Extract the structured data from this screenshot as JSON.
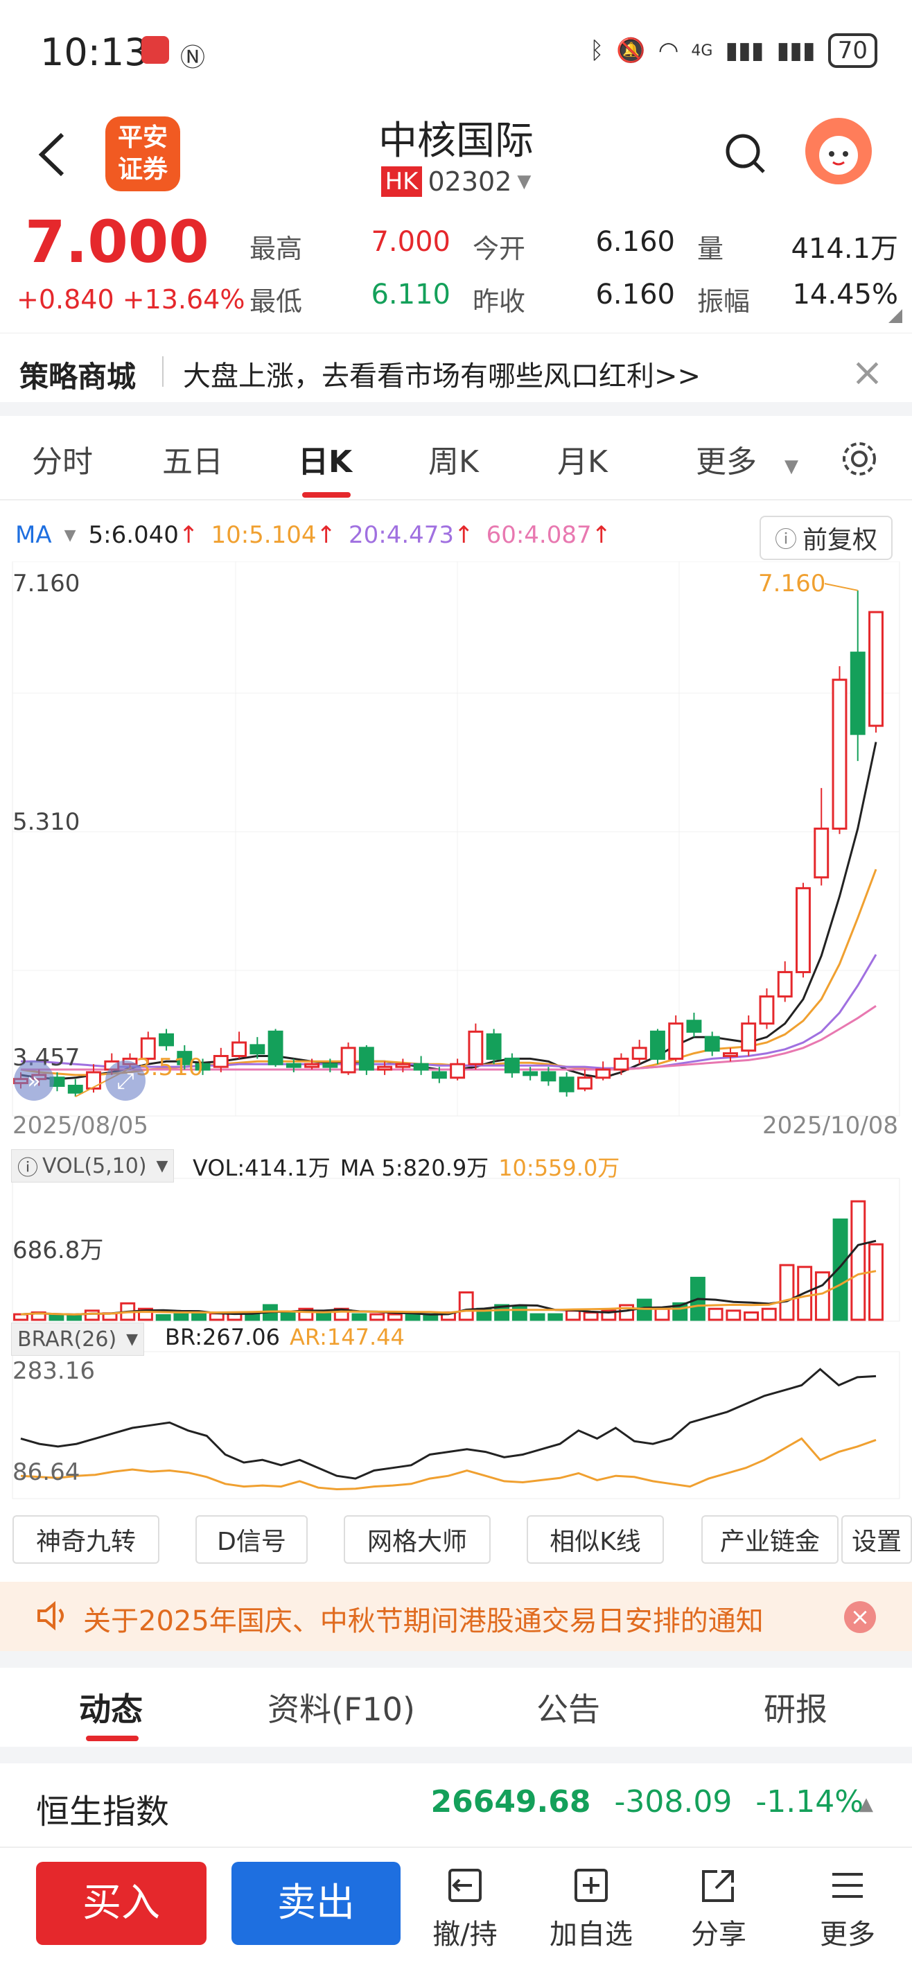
{
  "status": {
    "time": "10:13",
    "battery": "70",
    "net": "4G"
  },
  "header": {
    "stock_name": "中核国际",
    "market": "HK",
    "code": "02302",
    "broker_logo": "平安证券"
  },
  "quote": {
    "price": "7.000",
    "change": "+0.840",
    "change_pct": "+13.64%",
    "high_label": "最高",
    "high": "7.000",
    "low_label": "最低",
    "low": "6.110",
    "open_label": "今开",
    "open": "6.160",
    "prev_close_label": "昨收",
    "prev_close": "6.160",
    "volume_label": "量",
    "volume": "414.1万",
    "amplitude_label": "振幅",
    "amplitude": "14.45%"
  },
  "promo": {
    "title": "策略商城",
    "text": "大盘上涨，去看看市场有哪些风口红利>>"
  },
  "tabs": [
    {
      "label": "分时"
    },
    {
      "label": "五日"
    },
    {
      "label": "日K"
    },
    {
      "label": "周K"
    },
    {
      "label": "月K"
    },
    {
      "label": "更多"
    }
  ],
  "ma": {
    "label": "MA",
    "ma5": "5:6.040",
    "ma10": "10:5.104",
    "ma20": "20:4.473",
    "ma60": "60:4.087",
    "fq": "前复权"
  },
  "colors": {
    "red": "#e5282c",
    "green": "#14a05a",
    "ma5": "#222222",
    "ma10": "#f0a030",
    "ma20": "#a070e0",
    "ma60": "#e878b0"
  },
  "chart_data": {
    "type": "candlestick",
    "y_labels": [
      "7.160",
      "5.310",
      "3.457"
    ],
    "ylim": [
      3.4,
      7.2
    ],
    "start_date": "2025/08/05",
    "end_date": "2025/10/08",
    "max_label": "7.160",
    "min_label": "3.510",
    "candles": [
      [
        3.52,
        3.55,
        3.6,
        3.48
      ],
      [
        3.55,
        3.58,
        3.62,
        3.5
      ],
      [
        3.56,
        3.5,
        3.6,
        3.46
      ],
      [
        3.5,
        3.45,
        3.55,
        3.42
      ],
      [
        3.48,
        3.6,
        3.66,
        3.45
      ],
      [
        3.62,
        3.68,
        3.74,
        3.58
      ],
      [
        3.66,
        3.7,
        3.74,
        3.62
      ],
      [
        3.7,
        3.85,
        3.9,
        3.66
      ],
      [
        3.88,
        3.8,
        3.92,
        3.76
      ],
      [
        3.75,
        3.66,
        3.8,
        3.62
      ],
      [
        3.66,
        3.62,
        3.7,
        3.58
      ],
      [
        3.64,
        3.72,
        3.78,
        3.6
      ],
      [
        3.72,
        3.82,
        3.9,
        3.7
      ],
      [
        3.8,
        3.74,
        3.86,
        3.7
      ],
      [
        3.9,
        3.66,
        3.92,
        3.64
      ],
      [
        3.66,
        3.64,
        3.7,
        3.6
      ],
      [
        3.64,
        3.66,
        3.7,
        3.62
      ],
      [
        3.66,
        3.64,
        3.7,
        3.6
      ],
      [
        3.6,
        3.78,
        3.82,
        3.58
      ],
      [
        3.78,
        3.62,
        3.8,
        3.58
      ],
      [
        3.62,
        3.64,
        3.68,
        3.58
      ],
      [
        3.64,
        3.66,
        3.7,
        3.6
      ],
      [
        3.66,
        3.62,
        3.72,
        3.58
      ],
      [
        3.6,
        3.56,
        3.64,
        3.52
      ],
      [
        3.56,
        3.66,
        3.7,
        3.54
      ],
      [
        3.66,
        3.9,
        3.96,
        3.62
      ],
      [
        3.88,
        3.7,
        3.92,
        3.66
      ],
      [
        3.7,
        3.6,
        3.74,
        3.56
      ],
      [
        3.6,
        3.58,
        3.64,
        3.54
      ],
      [
        3.6,
        3.54,
        3.64,
        3.5
      ],
      [
        3.56,
        3.46,
        3.6,
        3.42
      ],
      [
        3.48,
        3.56,
        3.62,
        3.46
      ],
      [
        3.56,
        3.62,
        3.68,
        3.54
      ],
      [
        3.62,
        3.7,
        3.74,
        3.58
      ],
      [
        3.7,
        3.78,
        3.84,
        3.66
      ],
      [
        3.9,
        3.7,
        3.92,
        3.66
      ],
      [
        3.7,
        3.96,
        4.02,
        3.68
      ],
      [
        3.98,
        3.9,
        4.04,
        3.86
      ],
      [
        3.86,
        3.76,
        3.9,
        3.72
      ],
      [
        3.72,
        3.74,
        3.78,
        3.68
      ],
      [
        3.76,
        3.96,
        4.02,
        3.72
      ],
      [
        3.96,
        4.16,
        4.22,
        3.92
      ],
      [
        4.16,
        4.34,
        4.42,
        4.12
      ],
      [
        4.34,
        4.96,
        5.0,
        4.3
      ],
      [
        5.04,
        5.4,
        5.7,
        4.98
      ],
      [
        5.4,
        6.5,
        6.6,
        5.36
      ],
      [
        6.7,
        6.1,
        7.16,
        5.9
      ],
      [
        6.16,
        7.0,
        7.0,
        6.11
      ]
    ],
    "ma_lines": {
      "ma5": [
        3.58,
        3.56,
        3.55,
        3.56,
        3.58,
        3.6,
        3.63,
        3.66,
        3.68,
        3.68,
        3.67,
        3.68,
        3.7,
        3.72,
        3.72,
        3.7,
        3.68,
        3.67,
        3.67,
        3.68,
        3.68,
        3.66,
        3.64,
        3.62,
        3.62,
        3.64,
        3.68,
        3.7,
        3.7,
        3.68,
        3.62,
        3.58,
        3.56,
        3.6,
        3.66,
        3.72,
        3.8,
        3.86,
        3.86,
        3.84,
        3.82,
        3.86,
        3.96,
        4.14,
        4.46,
        4.9,
        5.4,
        6.04
      ],
      "ma10": [
        3.62,
        3.6,
        3.59,
        3.58,
        3.58,
        3.59,
        3.6,
        3.62,
        3.63,
        3.64,
        3.65,
        3.66,
        3.67,
        3.68,
        3.68,
        3.68,
        3.68,
        3.68,
        3.68,
        3.68,
        3.68,
        3.67,
        3.66,
        3.66,
        3.65,
        3.65,
        3.66,
        3.67,
        3.67,
        3.66,
        3.64,
        3.63,
        3.62,
        3.62,
        3.63,
        3.66,
        3.7,
        3.74,
        3.77,
        3.78,
        3.79,
        3.82,
        3.88,
        3.98,
        4.14,
        4.4,
        4.74,
        5.1
      ],
      "ma20": [
        3.68,
        3.68,
        3.67,
        3.66,
        3.65,
        3.64,
        3.64,
        3.64,
        3.64,
        3.64,
        3.65,
        3.65,
        3.66,
        3.66,
        3.66,
        3.66,
        3.66,
        3.66,
        3.66,
        3.66,
        3.66,
        3.66,
        3.66,
        3.65,
        3.65,
        3.65,
        3.65,
        3.65,
        3.65,
        3.65,
        3.64,
        3.64,
        3.63,
        3.63,
        3.63,
        3.64,
        3.66,
        3.68,
        3.7,
        3.71,
        3.72,
        3.74,
        3.77,
        3.82,
        3.9,
        4.04,
        4.24,
        4.47
      ],
      "ma60": [
        3.62,
        3.62,
        3.62,
        3.62,
        3.62,
        3.62,
        3.62,
        3.62,
        3.62,
        3.62,
        3.62,
        3.62,
        3.62,
        3.62,
        3.62,
        3.62,
        3.62,
        3.62,
        3.62,
        3.62,
        3.62,
        3.62,
        3.62,
        3.62,
        3.62,
        3.62,
        3.62,
        3.62,
        3.62,
        3.62,
        3.62,
        3.62,
        3.62,
        3.62,
        3.63,
        3.64,
        3.65,
        3.66,
        3.67,
        3.68,
        3.69,
        3.71,
        3.74,
        3.78,
        3.84,
        3.92,
        4.0,
        4.09
      ]
    },
    "volume": {
      "header": "VOL(5,10)",
      "vol_text": "VOL:414.1万",
      "ma5_text": "MA 5:820.9万",
      "ma10_text": "10:559.0万",
      "y_label": "686.8万",
      "ylim": [
        0,
        700
      ],
      "values": [
        30,
        40,
        25,
        20,
        50,
        35,
        90,
        60,
        25,
        30,
        30,
        35,
        40,
        30,
        80,
        40,
        60,
        40,
        60,
        30,
        30,
        30,
        25,
        30,
        40,
        150,
        60,
        80,
        70,
        30,
        30,
        50,
        40,
        50,
        80,
        110,
        60,
        90,
        230,
        60,
        50,
        40,
        60,
        300,
        290,
        260,
        550,
        650,
        414
      ]
    },
    "brar": {
      "header": "BRAR(26)",
      "br_text": "BR:267.06",
      "ar_text": "AR:147.44",
      "y_labels": [
        "283.16",
        "86.64"
      ],
      "ylim": [
        40,
        300
      ],
      "br": [
        150,
        140,
        135,
        140,
        150,
        160,
        170,
        175,
        180,
        165,
        155,
        120,
        105,
        110,
        100,
        110,
        95,
        80,
        75,
        90,
        95,
        100,
        120,
        125,
        130,
        125,
        115,
        120,
        130,
        140,
        165,
        150,
        170,
        145,
        140,
        150,
        180,
        190,
        200,
        215,
        230,
        240,
        250,
        280,
        250,
        265,
        267
      ],
      "ar": [
        80,
        78,
        76,
        80,
        82,
        88,
        92,
        88,
        90,
        86,
        78,
        65,
        60,
        62,
        60,
        70,
        58,
        55,
        56,
        60,
        62,
        65,
        75,
        80,
        90,
        80,
        70,
        68,
        72,
        76,
        85,
        72,
        80,
        78,
        70,
        65,
        60,
        75,
        85,
        95,
        110,
        130,
        150,
        110,
        125,
        135,
        147.44
      ]
    }
  },
  "tools": [
    {
      "label": "神奇九转"
    },
    {
      "label": "D信号"
    },
    {
      "label": "网格大师"
    },
    {
      "label": "相似K线"
    },
    {
      "label": "产业链金"
    },
    {
      "label": "设置"
    }
  ],
  "notice": {
    "text": "关于2025年国庆、中秋节期间港股通交易日安排的通知"
  },
  "subtabs": [
    {
      "label": "动态"
    },
    {
      "label": "资料(F10)"
    },
    {
      "label": "公告"
    },
    {
      "label": "研报"
    }
  ],
  "index": {
    "name": "恒生指数",
    "value": "26649.68",
    "change": "-308.09",
    "pct": "-1.14%"
  },
  "bottom": {
    "buy": "买入",
    "sell": "卖出",
    "items": [
      {
        "label": "撤/持"
      },
      {
        "label": "加自选"
      },
      {
        "label": "分享"
      },
      {
        "label": "更多"
      }
    ]
  }
}
